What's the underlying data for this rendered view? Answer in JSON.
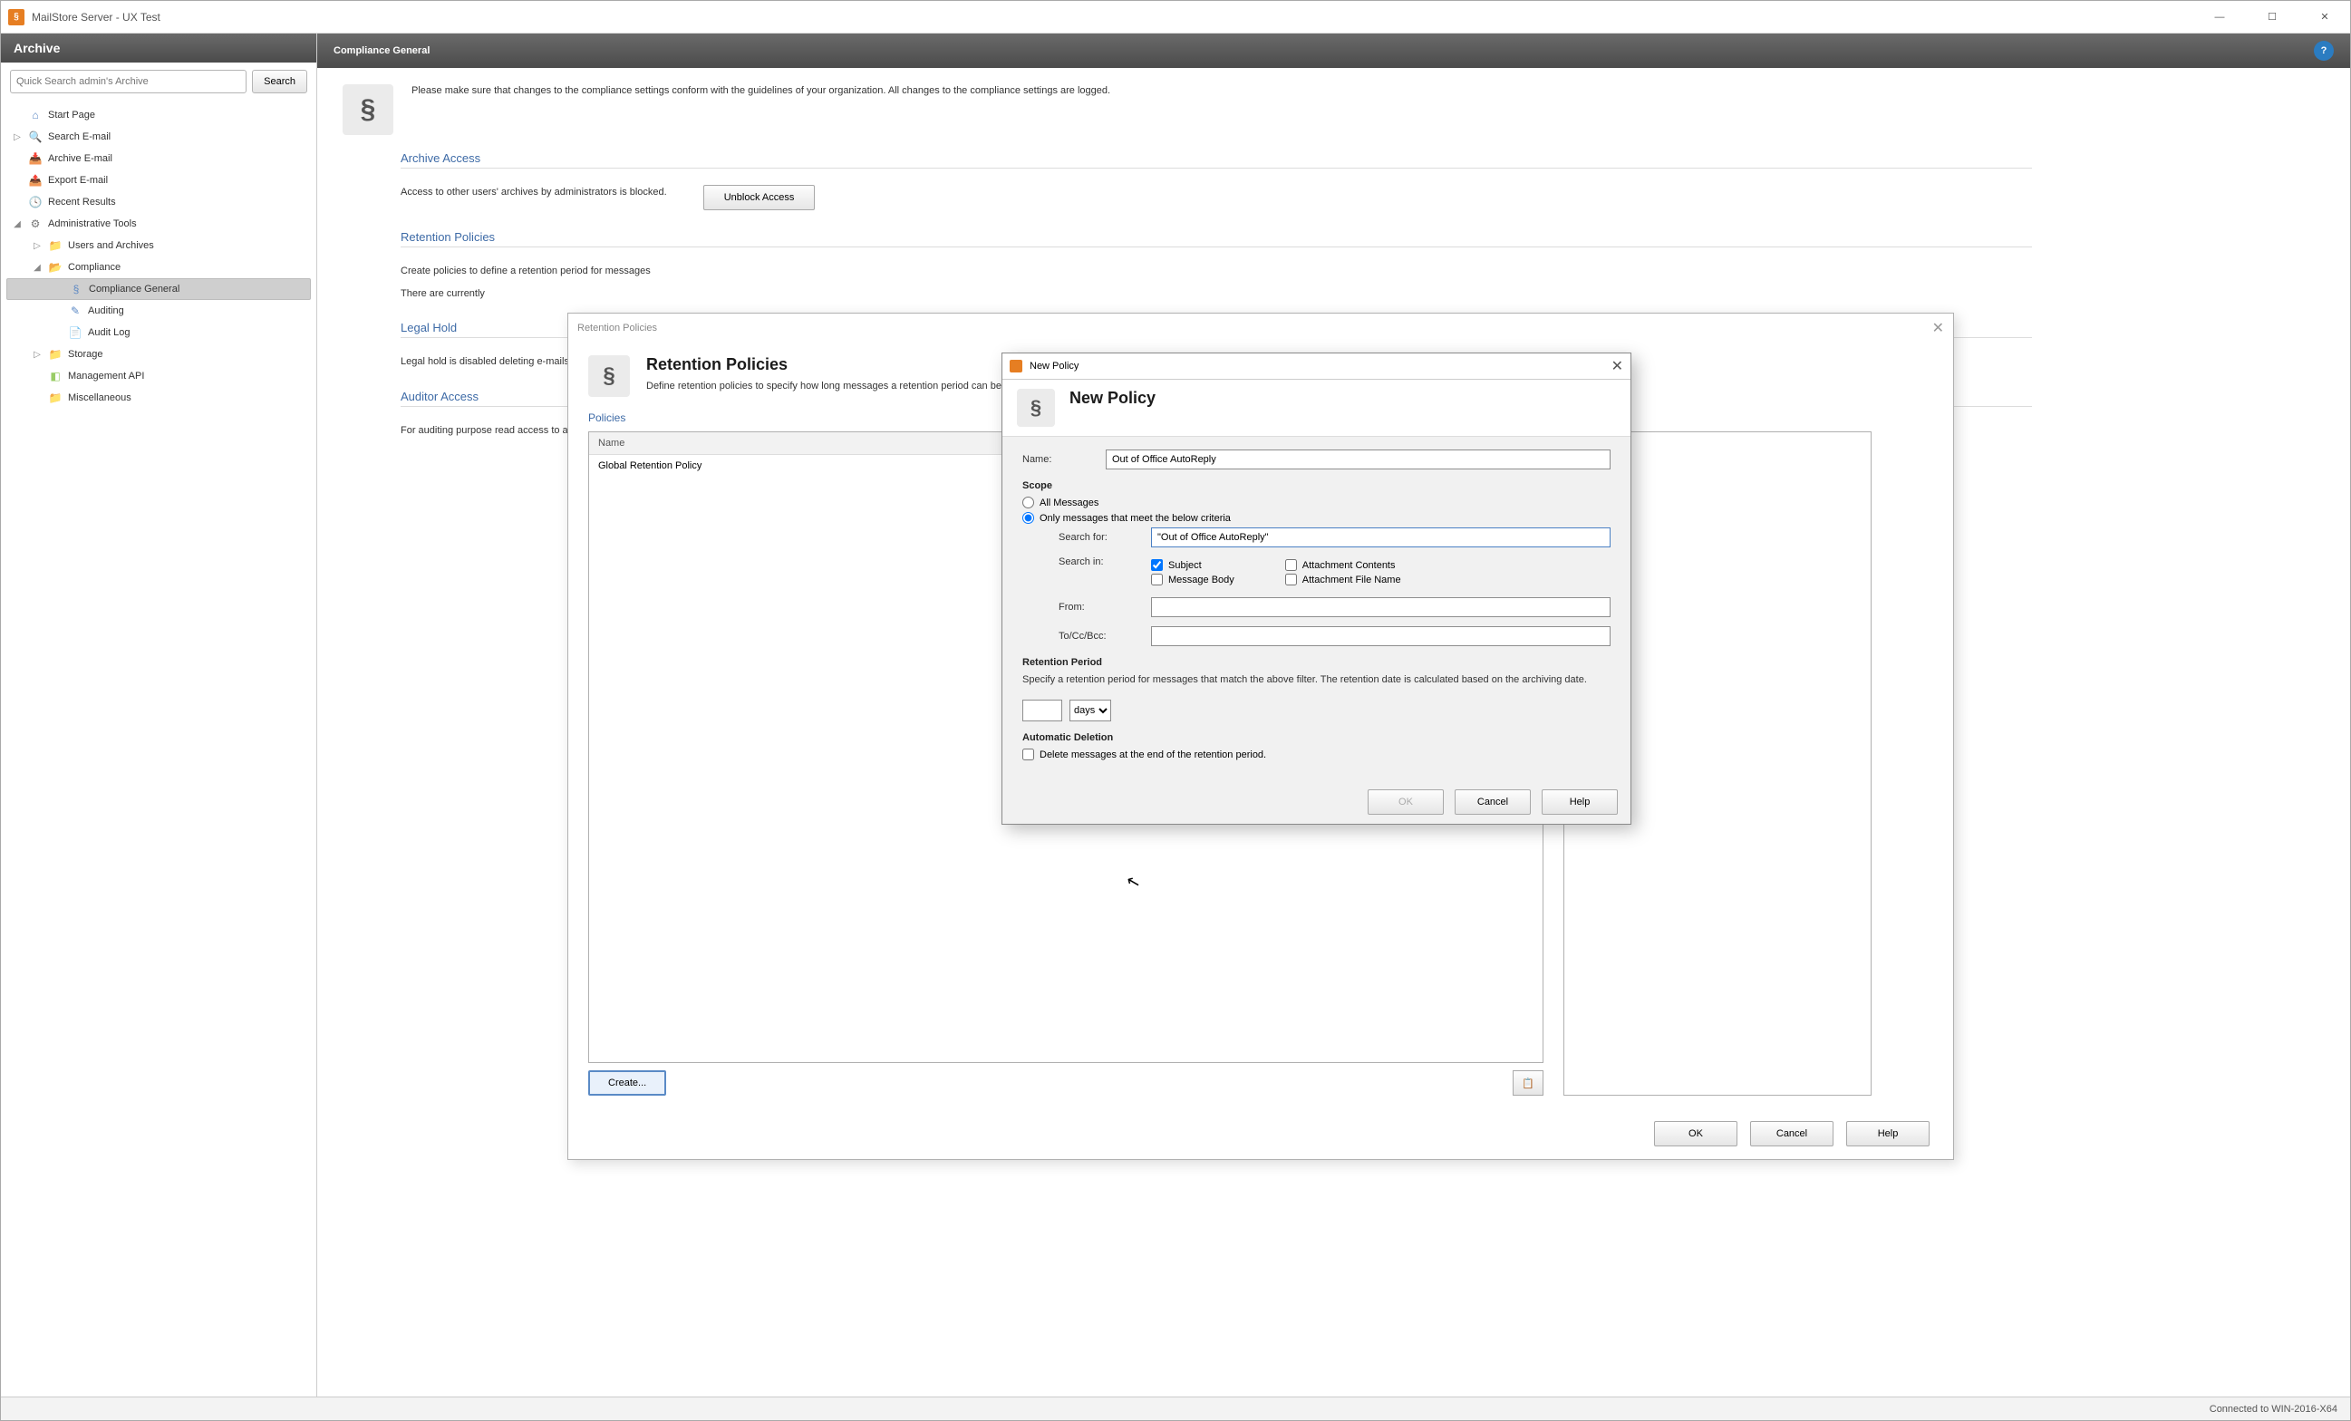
{
  "window": {
    "title": "MailStore Server - UX Test"
  },
  "sidebar": {
    "header": "Archive",
    "search_placeholder": "Quick Search admin's Archive",
    "search_btn": "Search",
    "tree": {
      "start_page": "Start Page",
      "search_email": "Search E-mail",
      "archive_email": "Archive E-mail",
      "export_email": "Export E-mail",
      "recent_results": "Recent Results",
      "admin_tools": "Administrative Tools",
      "users_archives": "Users and Archives",
      "compliance": "Compliance",
      "compliance_general": "Compliance General",
      "auditing": "Auditing",
      "audit_log": "Audit Log",
      "storage": "Storage",
      "management_api": "Management API",
      "miscellaneous": "Miscellaneous"
    }
  },
  "main": {
    "header_title": "Compliance General",
    "intro_text": "Please make sure that changes to the compliance settings conform with the guidelines of your organization. All changes to the compliance settings are logged.",
    "archive_access": {
      "title": "Archive Access",
      "body": "Access to other users' archives by administrators is blocked.",
      "button": "Unblock Access"
    },
    "retention_policies": {
      "title": "Retention Policies",
      "body1": "Create policies to define a retention period for messages",
      "body2": "There are currently"
    },
    "legal_hold": {
      "title": "Legal Hold",
      "body": "Legal hold is disabled deleting e-mails."
    },
    "auditor_access": {
      "title": "Auditor Access",
      "body": "For auditing purpose read access to all u"
    }
  },
  "ret_dialog": {
    "title": "Retention Policies",
    "heading": "Retention Policies",
    "desc": "Define retention policies to specify how long messages a                                                                                                                                                                                     retention period can be enabled. Policies are processed from the top (highest priority) to the bottom.",
    "policies_label": "Policies",
    "col_name": "Name",
    "row1": "Global Retention Policy",
    "create_btn": "Create...",
    "ok": "OK",
    "cancel": "Cancel",
    "help": "Help"
  },
  "new_policy": {
    "title": "New Policy",
    "heading": "New Policy",
    "name_label": "Name:",
    "name_value": "Out of Office AutoReply",
    "scope_label": "Scope",
    "radio_all": "All Messages",
    "radio_criteria": "Only messages that meet the below criteria",
    "search_for_label": "Search for:",
    "search_for_value": "\"Out of Office AutoReply\"",
    "search_in_label": "Search in:",
    "chk_subject": "Subject",
    "chk_body": "Message Body",
    "chk_att_contents": "Attachment Contents",
    "chk_att_filename": "Attachment File Name",
    "from_label": "From:",
    "from_value": "",
    "to_label": "To/Cc/Bcc:",
    "to_value": "",
    "retention_label": "Retention Period",
    "retention_desc": "Specify a retention period for messages that match the above filter. The retention date is calculated based on the archiving date.",
    "period_unit": "days",
    "period_value": "",
    "auto_del_label": "Automatic Deletion",
    "auto_del_chk": "Delete messages at the end of the retention period.",
    "ok": "OK",
    "cancel": "Cancel",
    "help": "Help"
  },
  "statusbar": {
    "connected": "Connected to WIN-2016-X64"
  }
}
